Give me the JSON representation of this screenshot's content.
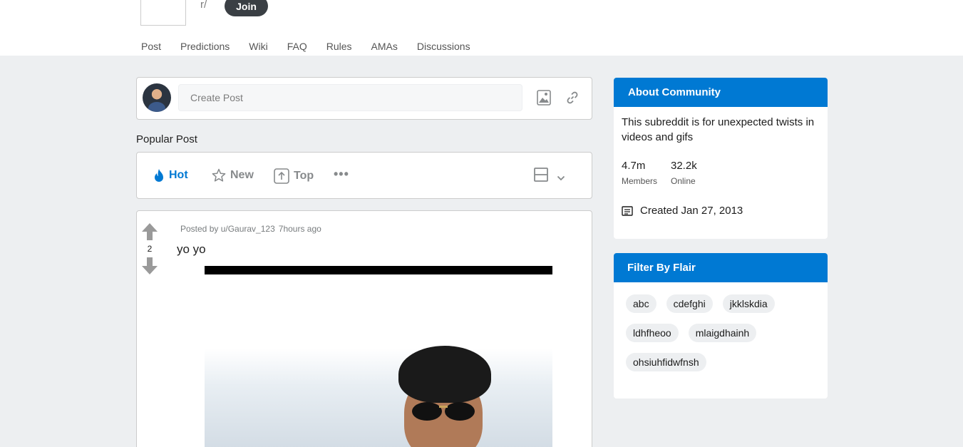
{
  "header": {
    "community_prefix": "r/",
    "join_label": "Join",
    "tabs": [
      "Post",
      "Predictions",
      "Wiki",
      "FAQ",
      "Rules",
      "AMAs",
      "Discussions"
    ]
  },
  "create_post": {
    "placeholder": "Create Post",
    "image_icon": "image-icon",
    "link_icon": "link-icon"
  },
  "feed": {
    "section_label": "Popular Post",
    "sort": {
      "hot": "Hot",
      "new": "New",
      "top": "Top",
      "more": "•••"
    }
  },
  "post": {
    "votes": "2",
    "posted_by": "Posted by u/Gaurav_123",
    "time": "7hours ago",
    "title": "yo yo"
  },
  "about": {
    "heading": "About Community",
    "description": "This subreddit is for unexpected twists in videos and gifs",
    "members_count": "4.7m",
    "members_label": "Members",
    "online_count": "32.2k",
    "online_label": "Online",
    "created": "Created Jan 27, 2013"
  },
  "flair": {
    "heading": "Filter By Flair",
    "items": [
      "abc",
      "cdefghi",
      "jkklskdia",
      "ldhfheoo",
      "mlaigdhainh",
      "ohsiuhfidwfnsh"
    ]
  },
  "colors": {
    "accent": "#0079d3",
    "join_button": "#3a3f44",
    "background": "#edeff1"
  }
}
